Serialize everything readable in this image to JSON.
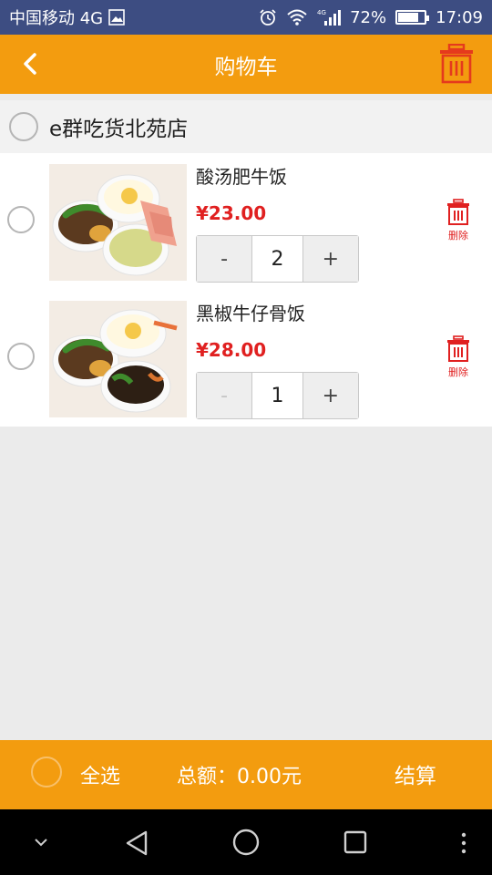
{
  "status_bar": {
    "carrier": "中国移动 4G",
    "battery_percent": "72%",
    "battery_level": 0.72,
    "time": "17:09",
    "icons": [
      "image-icon",
      "alarm-icon",
      "wifi-icon",
      "signal-icon",
      "battery-icon"
    ]
  },
  "header": {
    "title": "购物车",
    "back_icon": "chevron-left-icon",
    "trash_icon": "trash-icon"
  },
  "store": {
    "name": "e群吃货北苑店"
  },
  "items": [
    {
      "name": "酸汤肥牛饭",
      "price": "¥23.00",
      "quantity": "2",
      "minus": "-",
      "plus": "+",
      "delete_label": "删除"
    },
    {
      "name": "黑椒牛仔骨饭",
      "price": "¥28.00",
      "quantity": "1",
      "minus": "-",
      "plus": "+",
      "delete_label": "删除"
    }
  ],
  "footer": {
    "select_all": "全选",
    "total": "总额：0.00元",
    "checkout": "结算"
  },
  "colors": {
    "status_bar": "#3d4d82",
    "accent": "#f39c0f",
    "price": "#e02020",
    "delete": "#e02020"
  }
}
